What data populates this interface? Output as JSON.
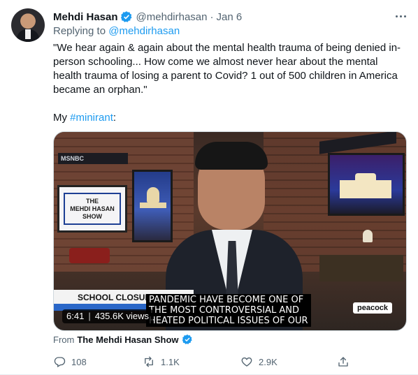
{
  "author": {
    "name": "Mehdi Hasan",
    "handle": "@mehdirhasan",
    "date": "Jan 6"
  },
  "reply": {
    "prefix": "Replying to",
    "to": "@mehdirhasan"
  },
  "tweet": {
    "text": "\"We hear again & again about the mental health trauma of being denied in-person schooling... How come we almost never hear about the mental health trauma of losing a parent to Covid? 1 out of 500 children in America became an orphan.\"",
    "my_prefix": "My",
    "hashtag": "#minirant",
    "suffix": ":"
  },
  "video": {
    "duration": "6:41",
    "views": "435.6K views",
    "lower_third": "SCHOOL CLOSURE DEBATE",
    "studio_sign": "MSNBC",
    "show_card": [
      "THE",
      "MEHDI HASAN",
      "SHOW"
    ],
    "caption_lines": [
      "PANDEMIC HAVE BECOME ONE OF",
      "THE MOST CONTROVERSIAL AND",
      "HEATED POLITICAL ISSUES OF OUR"
    ],
    "watermark": "peacock"
  },
  "source": {
    "prefix": "From",
    "name": "The Mehdi Hasan Show"
  },
  "actions": {
    "replies": "108",
    "retweets": "1.1K",
    "likes": "2.9K"
  },
  "colors": {
    "accent": "#1d9bf0",
    "secondary_text": "#536471"
  },
  "icons": {
    "verified": "verified-badge-icon",
    "more": "more-icon",
    "reply": "reply-icon",
    "retweet": "retweet-icon",
    "like": "like-icon",
    "share": "share-icon"
  }
}
